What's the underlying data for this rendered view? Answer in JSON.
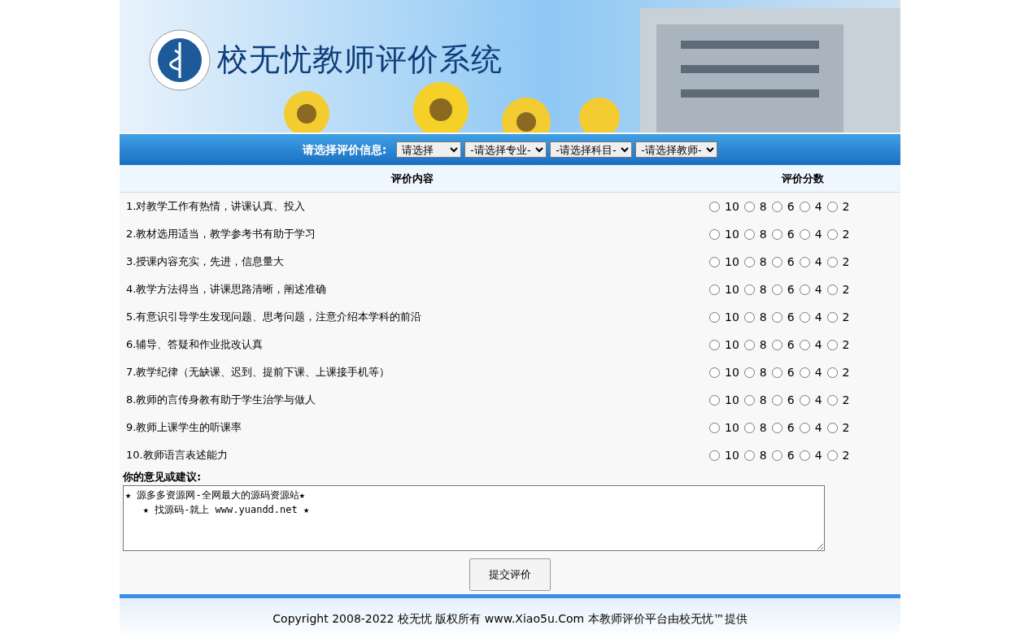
{
  "header": {
    "title": "校无忧教师评价系统"
  },
  "selector": {
    "label": "请选择评价信息:",
    "selects": [
      {
        "value": "请选择"
      },
      {
        "value": "-请选择专业-"
      },
      {
        "value": "-请选择科目-"
      },
      {
        "value": "-请选择教师-"
      }
    ]
  },
  "table": {
    "columns": [
      "评价内容",
      "评价分数"
    ],
    "rows": [
      {
        "text": "1.对教学工作有热情，讲课认真、投入",
        "options": [
          {
            "label": "10",
            "selected": false
          },
          {
            "label": "8",
            "selected": false
          },
          {
            "label": "6",
            "selected": false
          },
          {
            "label": "4",
            "selected": false
          },
          {
            "label": "2",
            "selected": false
          }
        ]
      },
      {
        "text": "2.教材选用适当，教学参考书有助于学习",
        "options": [
          {
            "label": "10",
            "selected": false
          },
          {
            "label": "8",
            "selected": false
          },
          {
            "label": "6",
            "selected": false
          },
          {
            "label": "4",
            "selected": false
          },
          {
            "label": "2",
            "selected": false
          }
        ]
      },
      {
        "text": "3.授课内容充实，先进，信息量大",
        "options": [
          {
            "label": "10",
            "selected": false
          },
          {
            "label": "8",
            "selected": false
          },
          {
            "label": "6",
            "selected": false
          },
          {
            "label": "4",
            "selected": false
          },
          {
            "label": "2",
            "selected": false
          }
        ]
      },
      {
        "text": "4.教学方法得当，讲课思路清晰，阐述准确",
        "options": [
          {
            "label": "10",
            "selected": false
          },
          {
            "label": "8",
            "selected": false
          },
          {
            "label": "6",
            "selected": false
          },
          {
            "label": "4",
            "selected": false
          },
          {
            "label": "2",
            "selected": false
          }
        ]
      },
      {
        "text": "5.有意识引导学生发现问题、思考问题，注意介绍本学科的前沿",
        "options": [
          {
            "label": "10",
            "selected": false
          },
          {
            "label": "8",
            "selected": false
          },
          {
            "label": "6",
            "selected": false
          },
          {
            "label": "4",
            "selected": false
          },
          {
            "label": "2",
            "selected": false
          }
        ]
      },
      {
        "text": "6.辅导、答疑和作业批改认真",
        "options": [
          {
            "label": "10",
            "selected": false
          },
          {
            "label": "8",
            "selected": false
          },
          {
            "label": "6",
            "selected": false
          },
          {
            "label": "4",
            "selected": false
          },
          {
            "label": "2",
            "selected": false
          }
        ]
      },
      {
        "text": "7.教学纪律（无缺课、迟到、提前下课、上课接手机等）",
        "options": [
          {
            "label": "10",
            "selected": false
          },
          {
            "label": "8",
            "selected": false
          },
          {
            "label": "6",
            "selected": false
          },
          {
            "label": "4",
            "selected": false
          },
          {
            "label": "2",
            "selected": false
          }
        ]
      },
      {
        "text": "8.教师的言传身教有助于学生治学与做人",
        "options": [
          {
            "label": "10",
            "selected": false
          },
          {
            "label": "8",
            "selected": false
          },
          {
            "label": "6",
            "selected": false
          },
          {
            "label": "4",
            "selected": false
          },
          {
            "label": "2",
            "selected": false
          }
        ]
      },
      {
        "text": "9.教师上课学生的听课率",
        "options": [
          {
            "label": "10",
            "selected": false
          },
          {
            "label": "8",
            "selected": false
          },
          {
            "label": "6",
            "selected": false
          },
          {
            "label": "4",
            "selected": false
          },
          {
            "label": "2",
            "selected": false
          }
        ]
      },
      {
        "text": "10.教师语言表述能力",
        "options": [
          {
            "label": "10",
            "selected": false
          },
          {
            "label": "8",
            "selected": false
          },
          {
            "label": "6",
            "selected": false
          },
          {
            "label": "4",
            "selected": false
          },
          {
            "label": "2",
            "selected": false
          }
        ]
      }
    ]
  },
  "comment": {
    "label": "你的意见或建议:",
    "value": "★ 源多多资源网-全网最大的源码资源站★\n   ★ 找源码-就上 www.yuandd.net ★"
  },
  "submit": "提交评价",
  "footer": "Copyright 2008-2022 校无忧 版权所有 www.Xiao5u.Com 本教师评价平台由校无忧™提供"
}
